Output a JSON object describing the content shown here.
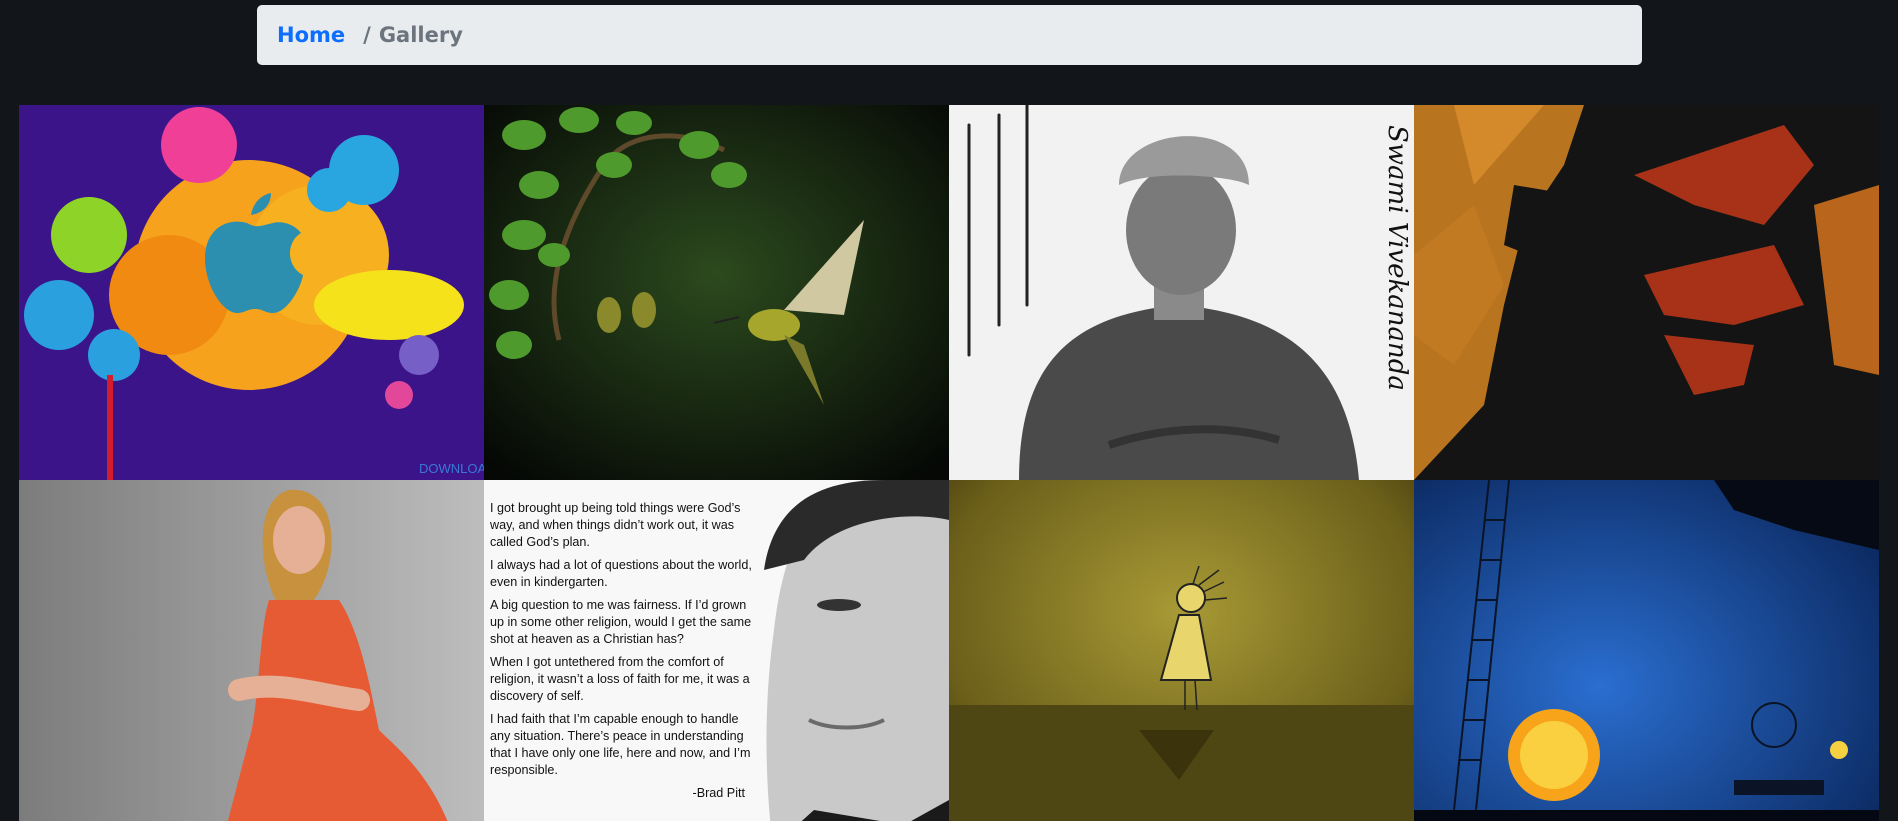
{
  "breadcrumb": {
    "home": "Home",
    "separator": "/",
    "current": "Gallery"
  },
  "gallery": {
    "images": [
      {
        "subject": "apple-logo-paint-splash",
        "text": "DOWNLOADS"
      },
      {
        "subject": "hummingbirds-feeding"
      },
      {
        "subject": "swami-vivekananda-portrait",
        "text": "Swami Vivekananda"
      },
      {
        "subject": "abstract-face-art"
      },
      {
        "subject": "woman-in-orange-dress"
      },
      {
        "subject": "brad-pitt-quote",
        "quote": [
          "I got brought up being told things were God’s way, and when things didn’t work out, it was called God’s plan.",
          "I always had a lot of questions about the world, even in kindergarten.",
          "A big question to me was fairness. If I’d grown up in some other religion, would I get the same shot at heaven as a Christian has?",
          "When I got untethered from the comfort of religion, it wasn’t a loss of faith for me, it was a discovery of self.",
          "I had faith that I’m capable enough to handle any situation. There’s peace in understanding that I have only one life, here and now, and I’m responsible."
        ],
        "attribution": "-Brad Pitt"
      },
      {
        "subject": "stick-figure-sun-illustration"
      },
      {
        "subject": "night-sun-ladder-illustration"
      }
    ]
  },
  "colors": {
    "background": "#121519",
    "breadcrumb_bg": "#e9ecef",
    "link": "#0d6efd",
    "muted": "#6c757d"
  }
}
